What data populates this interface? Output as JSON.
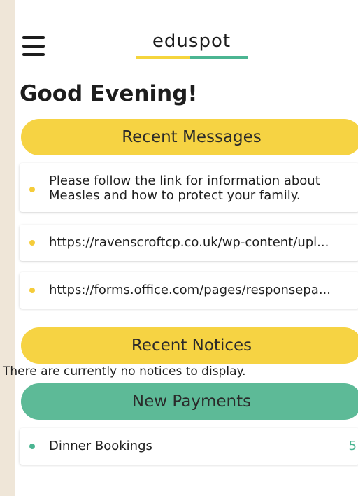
{
  "header": {
    "logo_text": "eduspot",
    "menu_icon": "hamburger-menu-icon"
  },
  "greeting": "Good Evening!",
  "messages": {
    "title": "Recent Messages",
    "items": [
      {
        "text": "Please follow the link for information about Measles and how to protect your family."
      },
      {
        "text": "https://ravenscroftcp.co.uk/wp-content/upl..."
      },
      {
        "text": "https://forms.office.com/pages/responsepa..."
      }
    ]
  },
  "notices": {
    "title": "Recent Notices",
    "empty_text": "There are currently no notices to display."
  },
  "payments": {
    "title": "New Payments",
    "items": [
      {
        "label": "Dinner Bookings",
        "count": "5"
      }
    ]
  },
  "colors": {
    "yellow": "#f6d343",
    "green": "#5dba97",
    "background": "#efe6d8"
  }
}
